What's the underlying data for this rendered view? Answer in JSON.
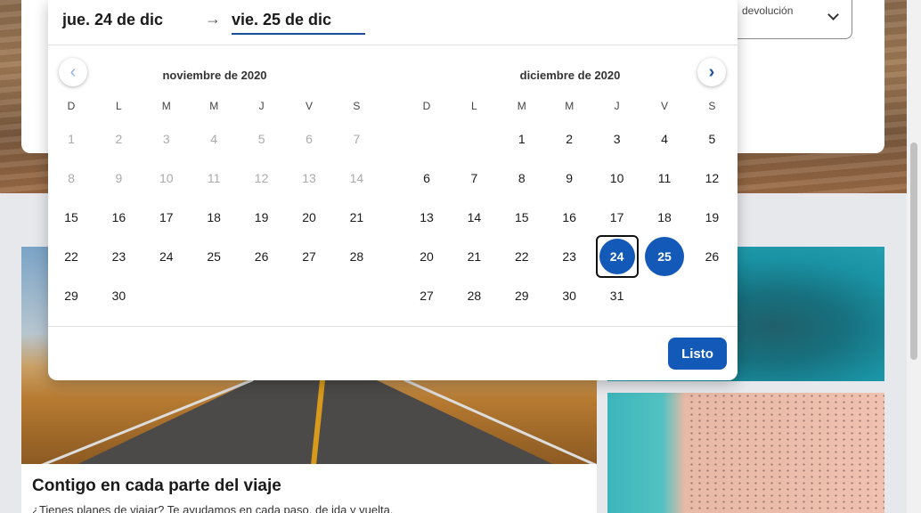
{
  "search": {
    "return_label": "devolución"
  },
  "picker": {
    "date_from": "jue. 24 de dic",
    "date_to": "vie. 25 de dic",
    "done_label": "Listo",
    "weekdays": [
      "D",
      "L",
      "M",
      "M",
      "J",
      "V",
      "S"
    ],
    "months": [
      {
        "title": "noviembre de 2020",
        "first_weekday": 0,
        "days": 30,
        "past_until": 15,
        "selected": [],
        "focused": null
      },
      {
        "title": "diciembre de 2020",
        "first_weekday": 2,
        "days": 31,
        "past_until": 0,
        "selected": [
          25
        ],
        "focused": 24
      }
    ]
  },
  "cards": {
    "big_title": "Contigo en cada parte del viaje",
    "big_desc": "¿Tienes planes de viajar? Te ayudamos en cada paso, de ida y vuelta."
  },
  "colors": {
    "accent": "#1359b8",
    "past_day": "#aaaaaa"
  }
}
